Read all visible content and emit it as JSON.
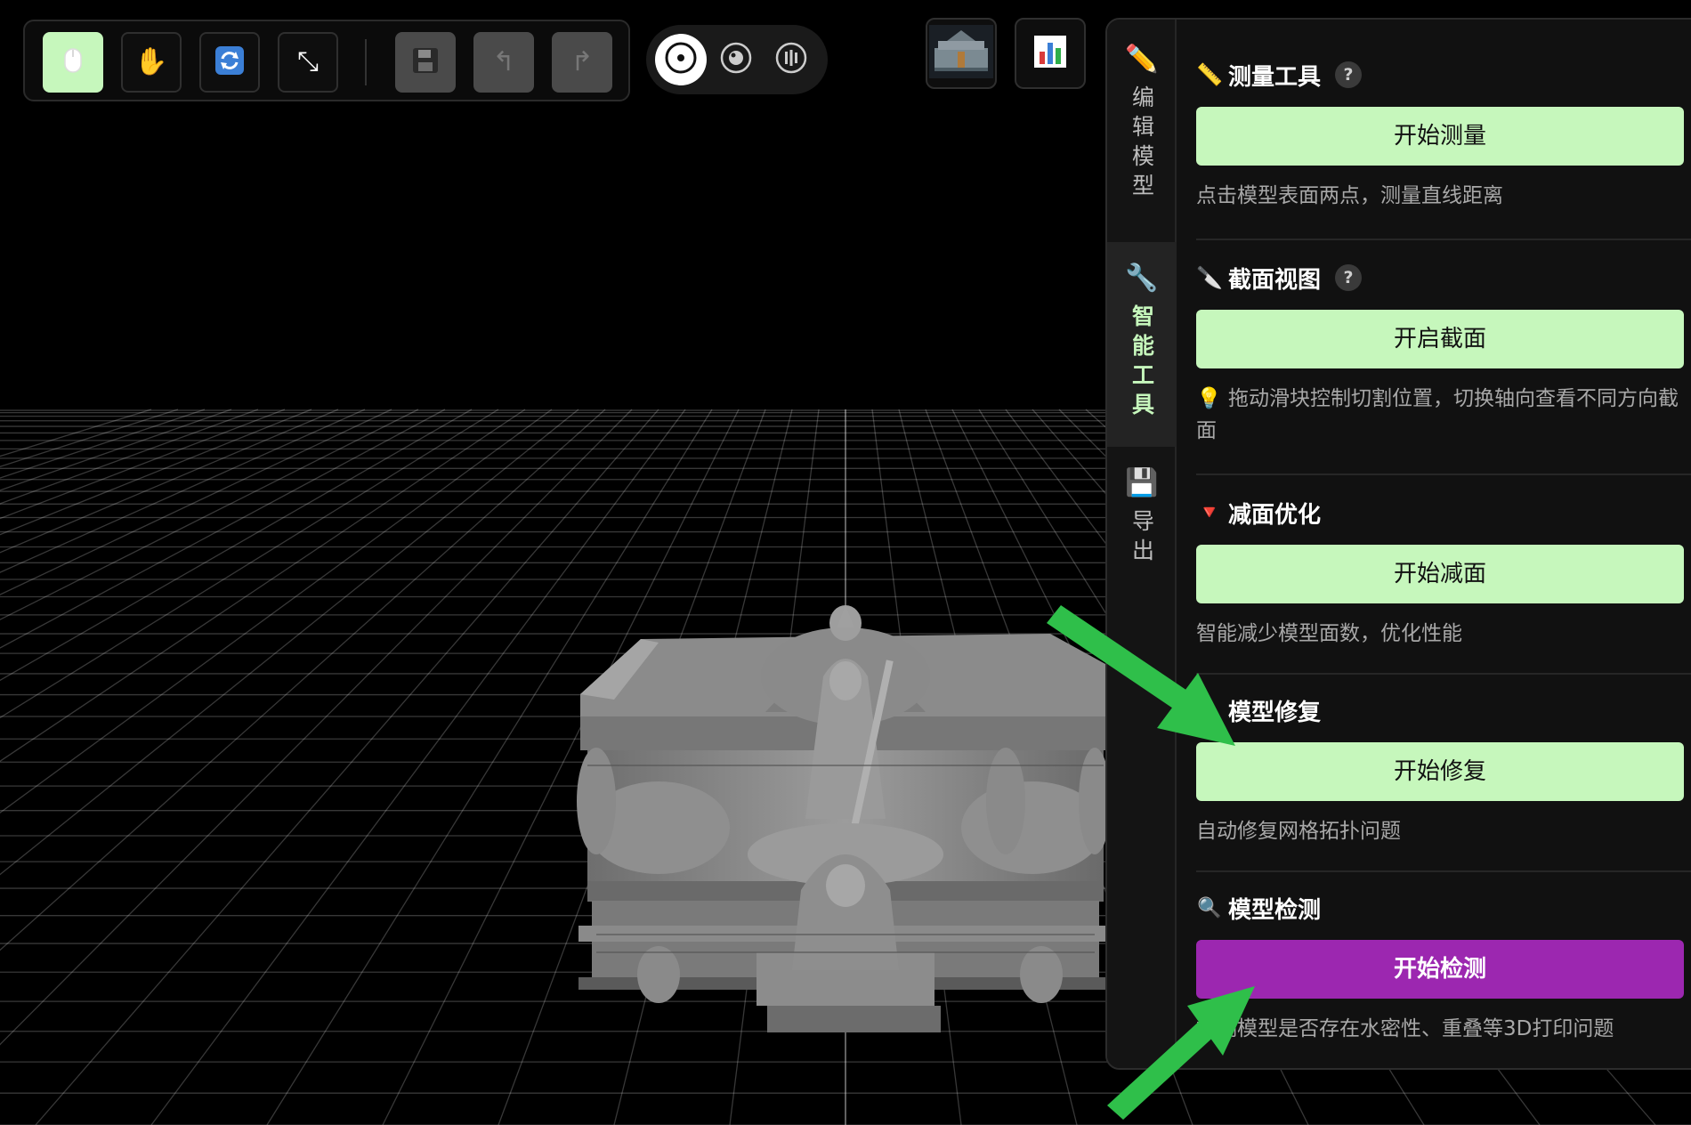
{
  "toolbar": {
    "tools": [
      {
        "name": "select-tool",
        "icon": "mouse-icon",
        "active": true
      },
      {
        "name": "pan-tool",
        "icon": "hand-icon",
        "glyph": "✋"
      },
      {
        "name": "rotate-tool",
        "icon": "rotate-icon"
      },
      {
        "name": "scale-tool",
        "icon": "resize-icon",
        "glyph": "⤡"
      },
      {
        "name": "save",
        "icon": "save-icon",
        "disabled": true
      },
      {
        "name": "undo",
        "icon": "undo-icon",
        "glyph": "↰",
        "disabled": true
      },
      {
        "name": "redo",
        "icon": "redo-icon",
        "glyph": "↱",
        "disabled": true
      }
    ],
    "view_modes": [
      "solid-view-icon",
      "material-view-icon",
      "wireframe-view-icon"
    ],
    "thumbnails": [
      "model-preview-thumbnail",
      "stats-chart-icon"
    ]
  },
  "side_tabs": [
    {
      "label": "编辑模型",
      "icon": "pencil-icon",
      "glyph": "✏️"
    },
    {
      "label": "智能工具",
      "icon": "wrench-icon",
      "glyph": "🔧",
      "active": true
    },
    {
      "label": "导出",
      "icon": "floppy-disk-icon",
      "glyph": "💾"
    }
  ],
  "sections": {
    "measure": {
      "icon": "ruler-icon",
      "glyph": "📏",
      "title": "测量工具",
      "help": "?",
      "button": "开始测量",
      "desc": "点击模型表面两点，测量直线距离"
    },
    "section_view": {
      "icon": "knife-icon",
      "glyph": "🔪",
      "title": "截面视图",
      "help": "?",
      "button": "开启截面",
      "desc": "💡 拖动滑块控制切割位置，切换轴向查看不同方向截面"
    },
    "decimate": {
      "icon": "triangle-down-icon",
      "glyph": "🔻",
      "title": "减面优化",
      "button": "开始减面",
      "desc": "智能减少模型面数，优化性能"
    },
    "repair": {
      "icon": "repair-icon",
      "glyph": "🔨",
      "title": "模型修复",
      "button": "开始修复",
      "desc": "自动修复网格拓扑问题"
    },
    "inspect": {
      "icon": "magnifier-icon",
      "glyph": "🔍",
      "title": "模型检测",
      "button": "开始检测",
      "desc": "检测模型是否存在水密性、重叠等3D打印问题"
    }
  },
  "colors": {
    "accent_green": "#c6f7bc",
    "accent_purple": "#9c27b0",
    "arrow_green": "#2fbf4a"
  }
}
